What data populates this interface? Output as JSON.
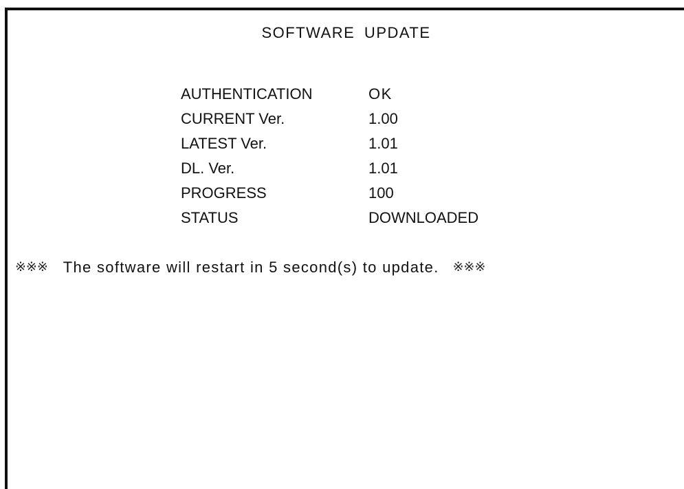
{
  "screen": {
    "title": "SOFTWARE UPDATE"
  },
  "info": [
    {
      "label": "AUTHENTICATION",
      "value": "OK"
    },
    {
      "label": "CURRENT Ver.",
      "value": "1.00"
    },
    {
      "label": "LATEST Ver.",
      "value": "1.01"
    },
    {
      "label": "DL. Ver.",
      "value": "1.01"
    },
    {
      "label": "PROGRESS",
      "value": "100"
    },
    {
      "label": "STATUS",
      "value": "DOWNLOADED"
    }
  ],
  "notice": {
    "prefix_marks": "※※※",
    "message": "The software will restart in 5 second(s) to update.",
    "suffix_marks": "※※※"
  },
  "colors": {
    "background": "#ffffff",
    "text": "#111111",
    "frame": "#111111"
  }
}
